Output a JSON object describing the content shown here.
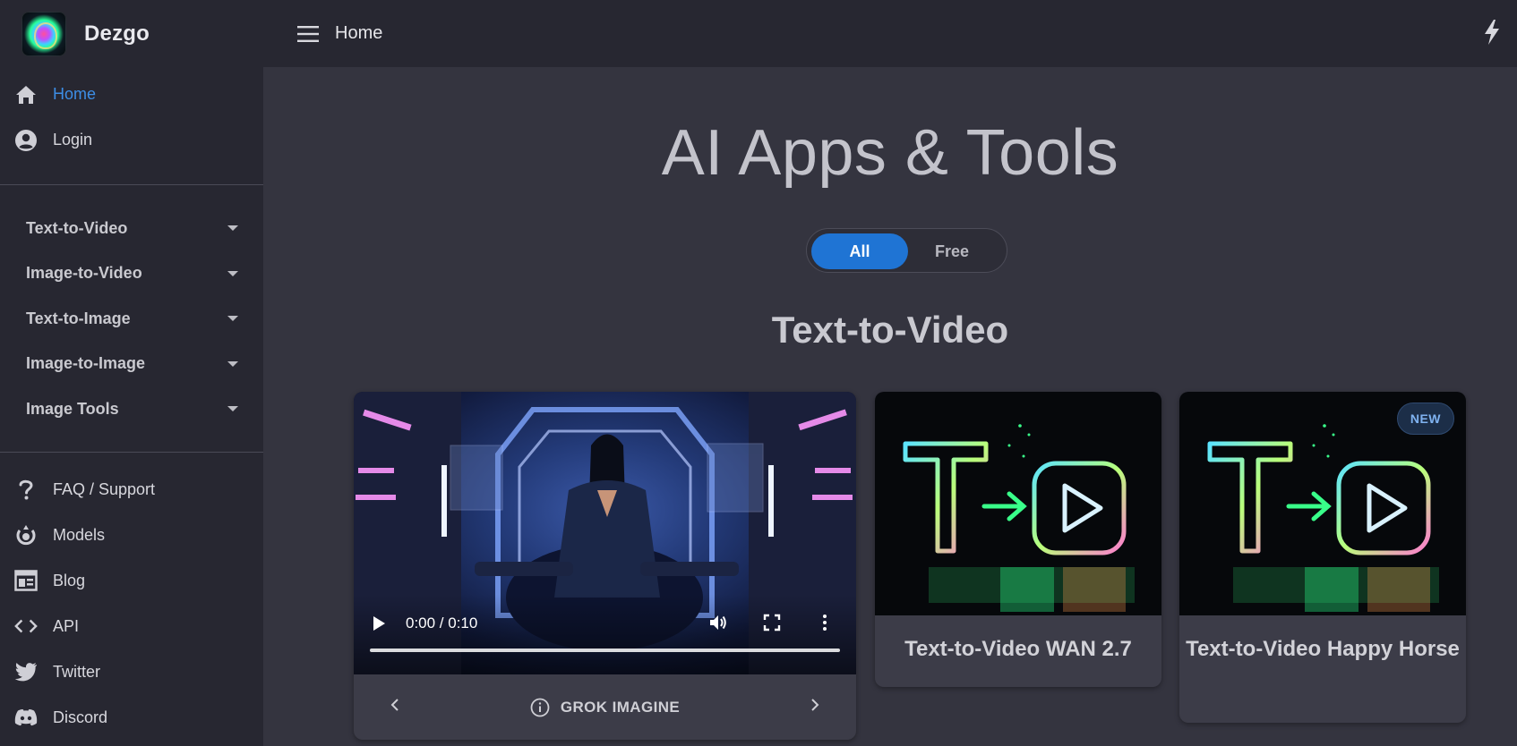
{
  "header": {
    "brand": "Dezgo",
    "breadcrumb": "Home"
  },
  "sidebar": {
    "primary": [
      {
        "label": "Home",
        "icon": "home-icon",
        "active": true
      },
      {
        "label": "Login",
        "icon": "account-icon",
        "active": false
      }
    ],
    "categories": [
      {
        "label": "Text-to-Video"
      },
      {
        "label": "Image-to-Video"
      },
      {
        "label": "Text-to-Image"
      },
      {
        "label": "Image-to-Image"
      },
      {
        "label": "Image Tools"
      }
    ],
    "links": [
      {
        "label": "FAQ / Support",
        "icon": "question-icon"
      },
      {
        "label": "Models",
        "icon": "models-icon"
      },
      {
        "label": "Blog",
        "icon": "blog-icon"
      },
      {
        "label": "API",
        "icon": "code-icon"
      },
      {
        "label": "Twitter",
        "icon": "twitter-icon"
      },
      {
        "label": "Discord",
        "icon": "discord-icon"
      }
    ]
  },
  "main": {
    "title": "AI Apps & Tools",
    "filter": {
      "options": [
        "All",
        "Free"
      ],
      "selected": "All"
    },
    "section_title": "Text-to-Video",
    "featured": {
      "time": "0:00 / 0:10",
      "label": "GROK IMAGINE"
    },
    "cards": [
      {
        "name": "Text-to-Video WAN 2.7",
        "badge": ""
      },
      {
        "name": "Text-to-Video Happy Horse",
        "badge": "NEW"
      }
    ]
  },
  "colors": {
    "accent": "#1f74d4",
    "active_link": "#3d8ee6",
    "background": "#34343f",
    "sidebar": "#272731"
  }
}
